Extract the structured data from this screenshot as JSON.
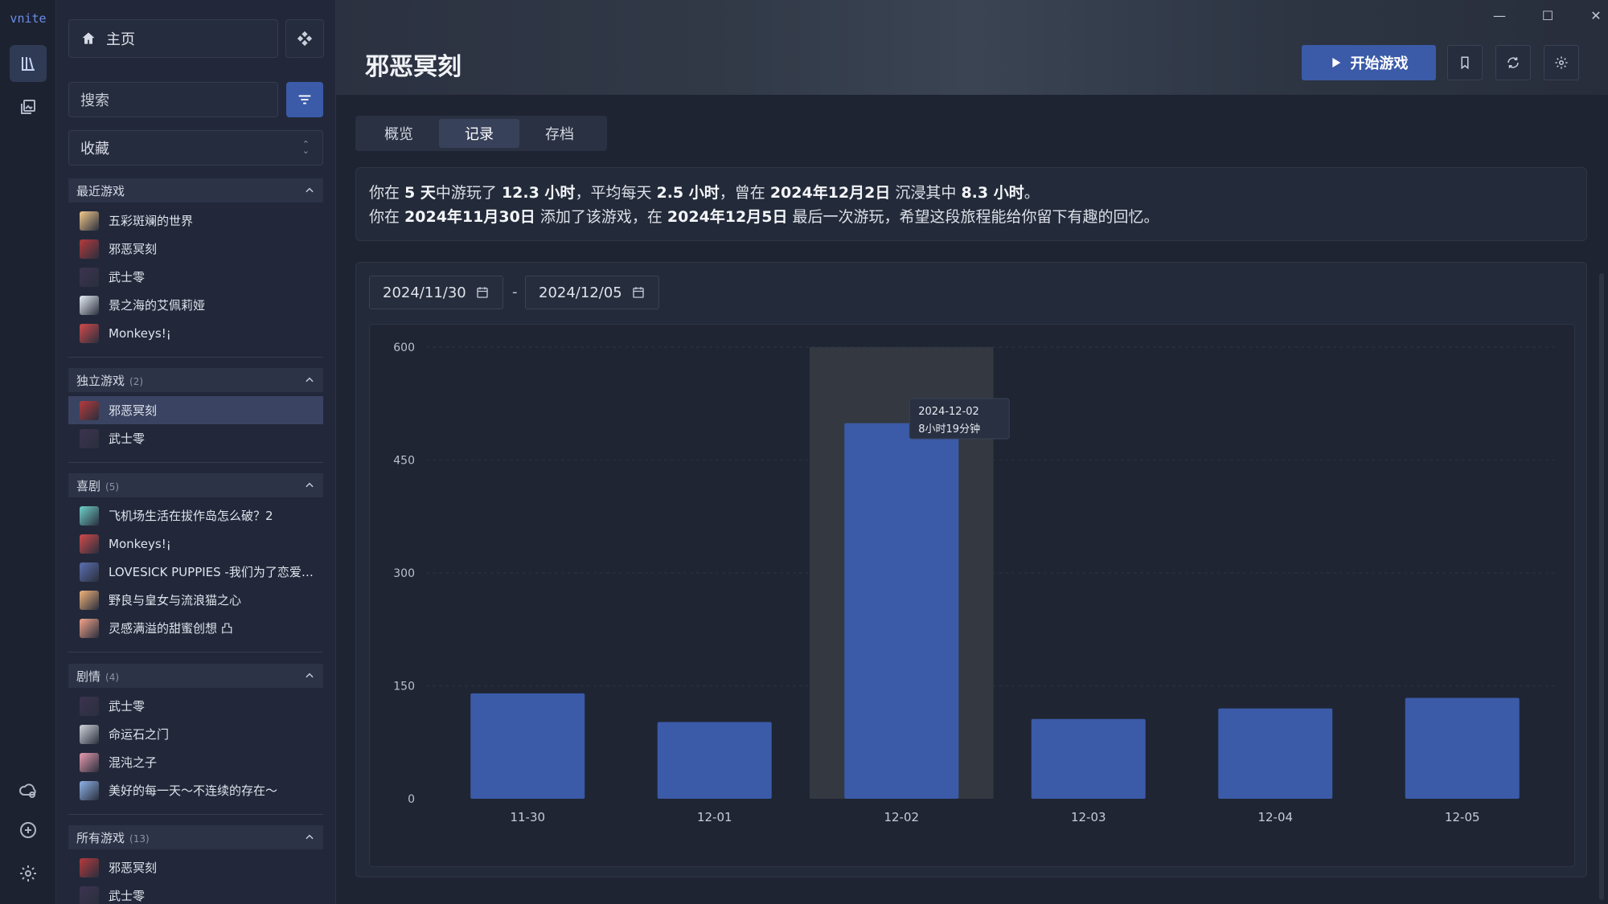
{
  "app": {
    "logo": "vnite"
  },
  "window": {
    "minimize": "—",
    "maximize": "☐",
    "close": "✕"
  },
  "sidebar": {
    "home_label": "主页",
    "search_placeholder": "搜索",
    "select_value": "收藏",
    "groups": [
      {
        "title": "最近游戏",
        "count": "",
        "items": [
          "五彩斑斓的世界",
          "邪恶冥刻",
          "武士零",
          "景之海的艾佩莉娅",
          "Monkeys!¡"
        ]
      },
      {
        "title": "独立游戏",
        "count": "(2)",
        "items": [
          "邪恶冥刻",
          "武士零"
        ]
      },
      {
        "title": "喜剧",
        "count": "(5)",
        "items": [
          "飞机场生活在拔作岛怎么破？2",
          "Monkeys!¡",
          "LOVESICK PUPPIES -我们为了恋爱…",
          "野良与皇女与流浪猫之心",
          "灵感满溢的甜蜜创想 凸"
        ]
      },
      {
        "title": "剧情",
        "count": "(4)",
        "items": [
          "武士零",
          "命运石之门",
          "混沌之子",
          "美好的每一天～不连续的存在～"
        ]
      },
      {
        "title": "所有游戏",
        "count": "(13)",
        "items": [
          "邪恶冥刻",
          "武士零"
        ]
      }
    ]
  },
  "game": {
    "title": "邪恶冥刻",
    "play_label": "开始游戏"
  },
  "tabs": [
    "概览",
    "记录",
    "存档"
  ],
  "stats": {
    "line1": {
      "p1": "你在 ",
      "days": "5 天",
      "p2": "中游玩了 ",
      "hours": "12.3 小时",
      "p3": "，平均每天 ",
      "avg": "2.5 小时",
      "p4": "，曾在 ",
      "peak_date": "2024年12月2日",
      "p5": " 沉浸其中 ",
      "peak_hours": "8.3 小时",
      "p6": "。"
    },
    "line2": {
      "p1": "你在 ",
      "added": "2024年11月30日",
      "p2": " 添加了该游戏，在 ",
      "last": "2024年12月5日",
      "p3": " 最后一次游玩，希望这段旅程能给你留下有趣的回忆。"
    }
  },
  "date_range": {
    "start": "2024/11/30",
    "sep": "-",
    "end": "2024/12/05"
  },
  "colors": {
    "accent": "#3b5ba8",
    "bar": "#3b5ba8"
  },
  "chart_data": {
    "type": "bar",
    "categories": [
      "11-30",
      "12-01",
      "12-02",
      "12-03",
      "12-04",
      "12-05"
    ],
    "values": [
      140,
      102,
      499,
      106,
      120,
      134
    ],
    "yticks": [
      0,
      150,
      300,
      450,
      600
    ],
    "ylim": [
      0,
      600
    ],
    "grid": true,
    "highlight_index": 2,
    "tooltip": {
      "date": "2024-12-02",
      "text": "8小时19分钟"
    }
  }
}
